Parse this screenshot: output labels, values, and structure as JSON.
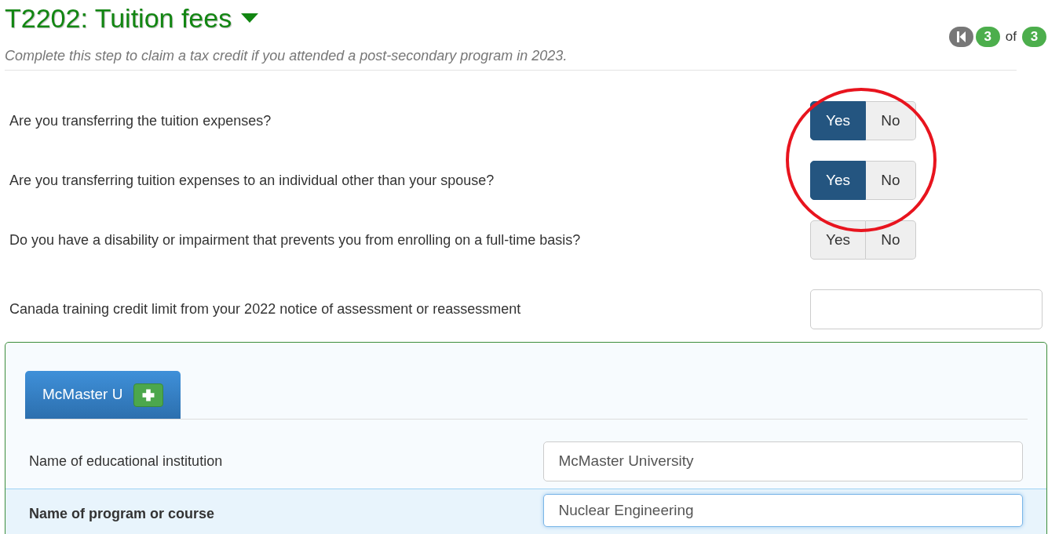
{
  "header": {
    "title": "T2202: Tuition fees",
    "subtitle": "Complete this step to claim a tax credit if you attended a post-secondary program in 2023.",
    "pager": {
      "current": "3",
      "of": "of",
      "total": "3"
    }
  },
  "questions": [
    {
      "kind": "toggle",
      "label": "Are you transferring the tuition expenses?",
      "options": [
        {
          "label": "Yes",
          "selected": true
        },
        {
          "label": "No",
          "selected": false
        }
      ]
    },
    {
      "kind": "toggle",
      "label": "Are you transferring tuition expenses to an individual other than your spouse?",
      "options": [
        {
          "label": "Yes",
          "selected": true
        },
        {
          "label": "No",
          "selected": false
        }
      ]
    },
    {
      "kind": "toggle",
      "label": "Do you have a disability or impairment that prevents you from enrolling on a full-time basis?",
      "options": [
        {
          "label": "Yes",
          "selected": false
        },
        {
          "label": "No",
          "selected": false
        }
      ]
    },
    {
      "kind": "text",
      "label": "Canada training credit limit from your 2022 notice of assessment or reassessment"
    }
  ],
  "annotation": {
    "kind": "circle"
  },
  "institutions": {
    "tabs": [
      {
        "label": "McMaster U",
        "selected": true
      }
    ],
    "fields": [
      {
        "label": "Name of educational institution",
        "value": "McMaster University",
        "focused": false
      },
      {
        "label": "Name of program or course",
        "value": "Nuclear Engineering",
        "focused": true
      }
    ]
  }
}
